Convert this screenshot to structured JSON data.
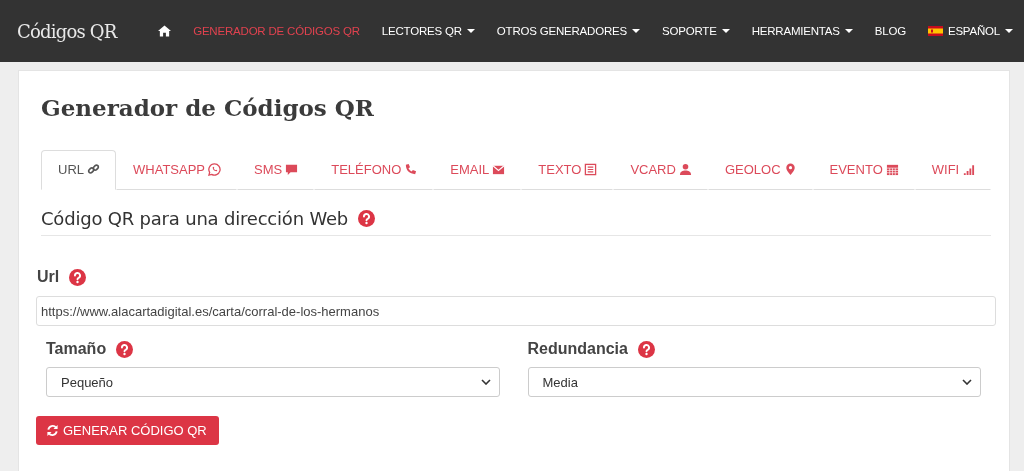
{
  "navbar": {
    "brand": "Códigos QR",
    "items": [
      {
        "kind": "home",
        "selected": false
      },
      {
        "kind": "link",
        "label": "GENERADOR DE CÓDIGOS QR",
        "selected": true,
        "dropdown": false
      },
      {
        "kind": "link",
        "label": "LECTORES QR",
        "selected": false,
        "dropdown": true
      },
      {
        "kind": "link",
        "label": "OTROS GENERADORES",
        "selected": false,
        "dropdown": true
      },
      {
        "kind": "link",
        "label": "SOPORTE",
        "selected": false,
        "dropdown": true
      },
      {
        "kind": "link",
        "label": "HERRAMIENTAS",
        "selected": false,
        "dropdown": true
      },
      {
        "kind": "link",
        "label": "BLOG",
        "selected": false,
        "dropdown": false
      },
      {
        "kind": "language",
        "label": "ESPAÑOL",
        "selected": false,
        "dropdown": true
      }
    ]
  },
  "page_title": "Generador de Códigos QR",
  "tabs": [
    {
      "label": "URL",
      "selected": true
    },
    {
      "label": "WHATSAPP",
      "selected": false
    },
    {
      "label": "SMS",
      "selected": false
    },
    {
      "label": "TELÉFONO",
      "selected": false
    },
    {
      "label": "EMAIL",
      "selected": false
    },
    {
      "label": "TEXTO",
      "selected": false
    },
    {
      "label": "VCARD",
      "selected": false
    },
    {
      "label": "GEOLOC",
      "selected": false
    },
    {
      "label": "EVENTO",
      "selected": false
    },
    {
      "label": "WIFI",
      "selected": false
    }
  ],
  "section_heading": "Código QR para una dirección Web",
  "url_field": {
    "label": "Url",
    "value": "https://www.alacartadigital.es/carta/corral-de-los-hermanos"
  },
  "selects": [
    {
      "label": "Tamaño",
      "value": "Pequeño"
    },
    {
      "label": "Redundancia",
      "value": "Media"
    }
  ],
  "button": "GENERAR CÓDIGO QR"
}
